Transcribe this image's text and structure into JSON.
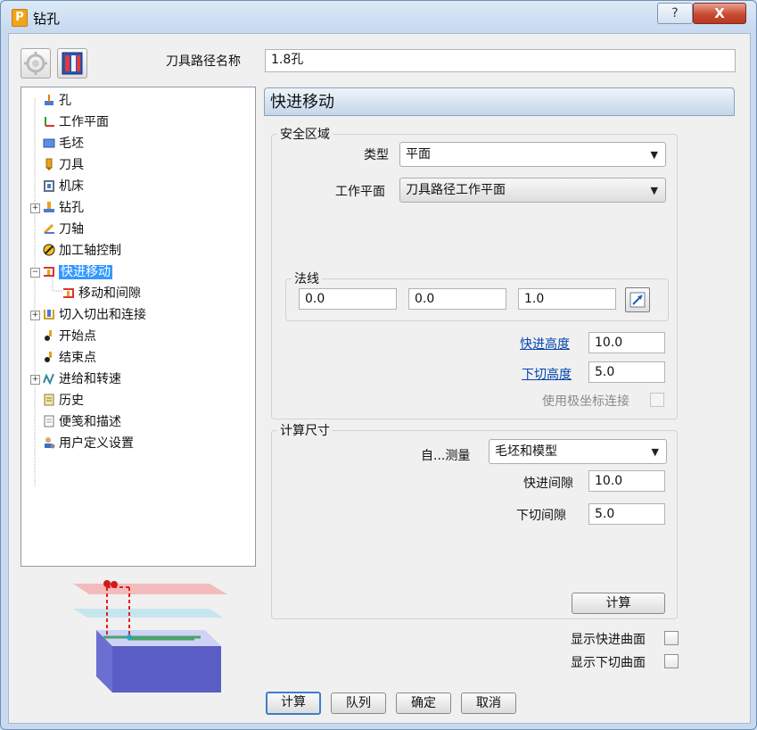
{
  "window": {
    "title": "钻孔",
    "app_icon_letter": "P",
    "help_glyph": "?",
    "close_glyph": "X"
  },
  "toolpath_name": {
    "label": "刀具路径名称",
    "value": "1.8孔"
  },
  "tree": {
    "items": [
      {
        "label": "孔",
        "icon": "hole-icon"
      },
      {
        "label": "工作平面",
        "icon": "workplane-icon"
      },
      {
        "label": "毛坯",
        "icon": "block-icon"
      },
      {
        "label": "刀具",
        "icon": "tool-icon"
      },
      {
        "label": "机床",
        "icon": "machine-icon"
      },
      {
        "label": "钻孔",
        "icon": "drilling-icon"
      },
      {
        "label": "刀轴",
        "icon": "tool-axis-icon"
      },
      {
        "label": "加工轴控制",
        "icon": "axis-control-icon"
      },
      {
        "label": "快进移动",
        "icon": "rapid-move-icon"
      },
      {
        "label": "移动和间隙",
        "icon": "moves-clearance-icon"
      },
      {
        "label": "切入切出和连接",
        "icon": "leads-links-icon"
      },
      {
        "label": "开始点",
        "icon": "start-point-icon"
      },
      {
        "label": "结束点",
        "icon": "end-point-icon"
      },
      {
        "label": "进给和转速",
        "icon": "feeds-speeds-icon"
      },
      {
        "label": "历史",
        "icon": "history-icon"
      },
      {
        "label": "便笺和描述",
        "icon": "notes-icon"
      },
      {
        "label": "用户定义设置",
        "icon": "user-settings-icon"
      }
    ]
  },
  "panel": {
    "title": "快进移动",
    "safe_area": {
      "title": "安全区域",
      "type_label": "类型",
      "type_value": "平面",
      "workplane_label": "工作平面",
      "workplane_value": "刀具路径工作平面",
      "normal": {
        "title": "法线",
        "x": "0.0",
        "y": "0.0",
        "z": "1.0"
      },
      "rapid_height_label": "快进高度",
      "rapid_height_value": "10.0",
      "plunge_height_label": "下切高度",
      "plunge_height_value": "5.0",
      "polar_label": "使用极坐标连接"
    },
    "calc_dims": {
      "title": "计算尺寸",
      "measure_label": "自...测量",
      "measure_value": "毛坯和模型",
      "rapid_gap_label": "快进间隙",
      "rapid_gap_value": "10.0",
      "plunge_gap_label": "下切间隙",
      "plunge_gap_value": "5.0",
      "calc_button": "计算"
    },
    "show_rapid_surface": "显示快进曲面",
    "show_plunge_surface": "显示下切曲面"
  },
  "buttons": {
    "calculate": "计算",
    "queue": "队列",
    "ok": "确定",
    "cancel": "取消"
  },
  "dropdown_arrow": "▼"
}
